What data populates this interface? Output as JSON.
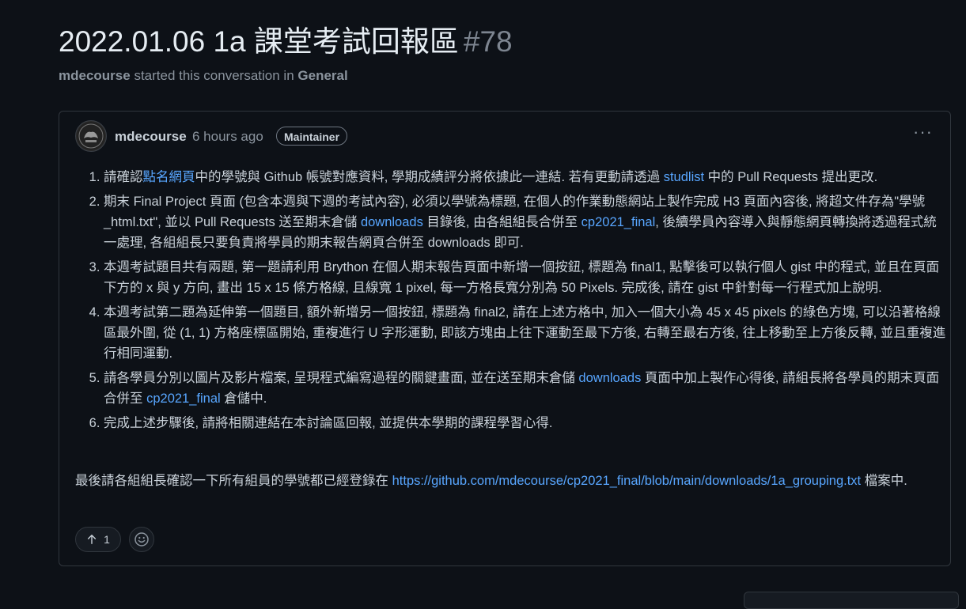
{
  "header": {
    "title": "2022.01.06 1a 課堂考試回報區",
    "number": "#78",
    "author": "mdecourse",
    "started_text": "started this conversation in",
    "category": "General"
  },
  "post": {
    "author": "mdecourse",
    "time": "6 hours ago",
    "badge": "Maintainer",
    "items": [
      {
        "pre": "請確認",
        "link": "點名網頁",
        "mid": "中的學號與 Github 帳號對應資料, 學期成績評分將依據此一連結. 若有更動請透過 ",
        "link2": "studlist",
        "post": " 中的 Pull Requests 提出更改."
      },
      {
        "pre": "期末 Final Project 頁面 (包含本週與下週的考試內容), 必須以學號為標題, 在個人的作業動態網站上製作完成 H3 頁面內容後, 將超文件存為\"學號_html.txt\", 並以 Pull Requests 送至期末倉儲 ",
        "link": "downloads",
        "mid": " 目錄後, 由各組組長合併至 ",
        "link2": "cp2021_final",
        "post": ", 後續學員內容導入與靜態網頁轉換將透過程式統一處理, 各組組長只要負責將學員的期末報告網頁合併至 downloads 即可."
      },
      {
        "text": "本週考試題目共有兩題, 第一題請利用 Brython 在個人期末報告頁面中新增一個按鈕, 標題為 final1, 點擊後可以執行個人 gist 中的程式, 並且在頁面下方的 x 與 y 方向, 畫出 15 x 15 條方格線, 且線寬 1 pixel, 每一方格長寬分別為 50 Pixels. 完成後, 請在 gist 中針對每一行程式加上說明."
      },
      {
        "text": "本週考試第二題為延伸第一個題目, 額外新增另一個按鈕, 標題為 final2, 請在上述方格中, 加入一個大小為 45 x 45 pixels 的綠色方塊, 可以沿著格線區最外圍, 從 (1, 1) 方格座標區開始, 重複進行 U 字形運動, 即該方塊由上往下運動至最下方後, 右轉至最右方後, 往上移動至上方後反轉, 並且重複進行相同運動."
      },
      {
        "pre": "請各學員分別以圖片及影片檔案, 呈現程式編寫過程的關鍵畫面, 並在送至期末倉儲 ",
        "link": "downloads",
        "mid": " 頁面中加上製作心得後, 請組長將各學員的期末頁面合併至 ",
        "link2": "cp2021_final",
        "post": " 倉儲中."
      },
      {
        "text": "完成上述步驟後, 請將相關連結在本討論區回報, 並提供本學期的課程學習心得."
      }
    ],
    "footer_pre": "最後請各組組長確認一下所有組員的學號都已經登錄在 ",
    "footer_link": "https://github.com/mdecourse/cp2021_final/blob/main/downloads/1a_grouping.txt",
    "footer_post": " 檔案中.",
    "upvote_count": "1",
    "more_label": "···"
  },
  "colors": {
    "background": "#0d1117",
    "link": "#58a6ff",
    "border": "#30363d"
  },
  "icons": [
    "avatar-image",
    "arrow-up-icon",
    "smiley-icon",
    "kebab-menu-icon"
  ]
}
